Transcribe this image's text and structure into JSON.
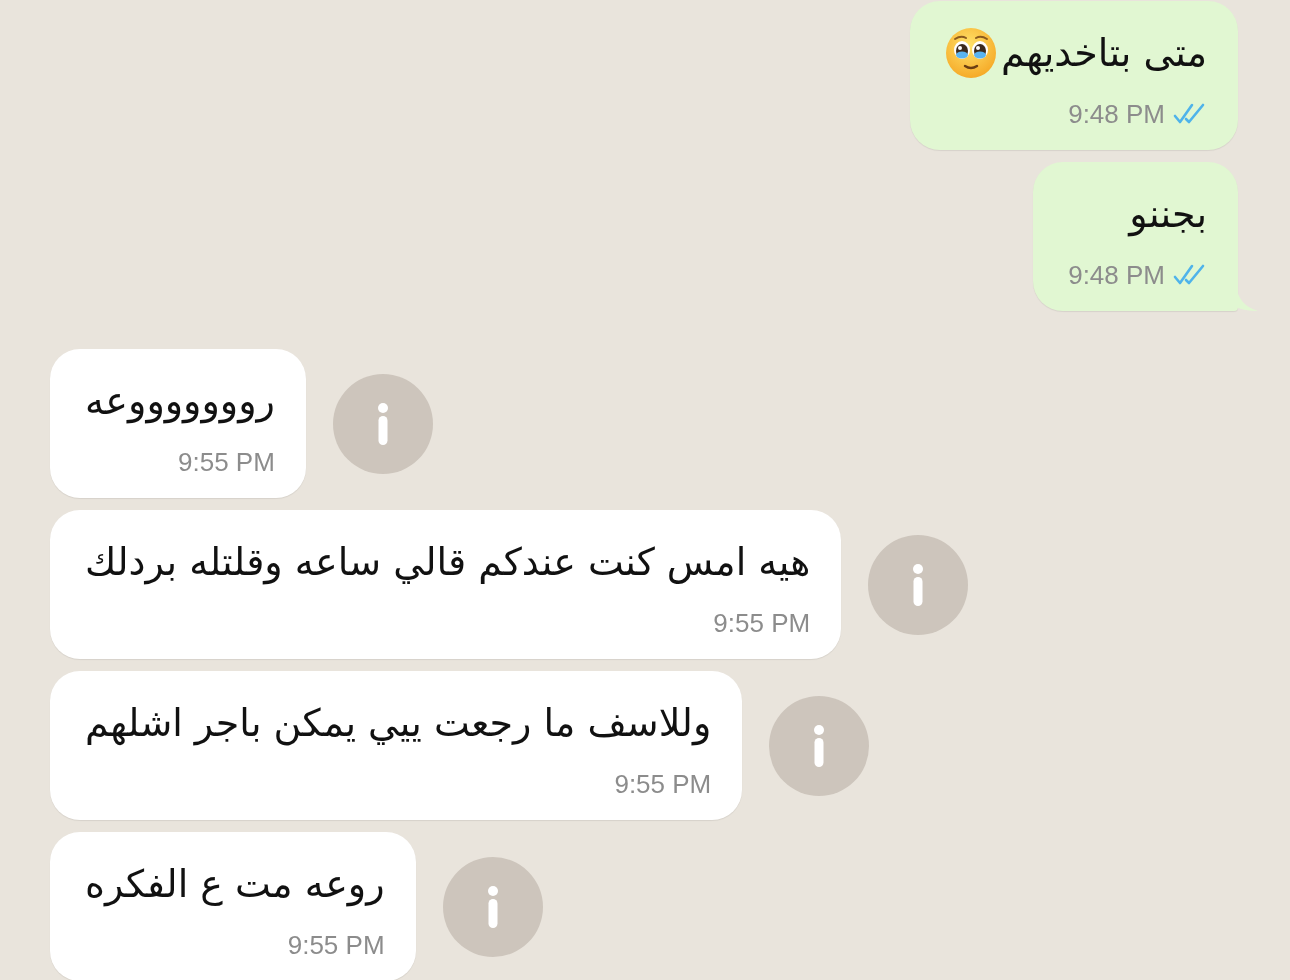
{
  "messages": [
    {
      "kind": "outgoing",
      "text": "متى بتاخديهم",
      "trailing_emoji": true,
      "time": "9:48 PM",
      "read": true,
      "tail": false
    },
    {
      "kind": "outgoing",
      "text": "بجننو",
      "trailing_emoji": false,
      "time": "9:48 PM",
      "read": true,
      "tail": true
    },
    {
      "kind": "incoming",
      "text": "روووووووعه",
      "trailing_emoji": false,
      "time": "9:55 PM",
      "tail": false
    },
    {
      "kind": "incoming",
      "text": "هيه امس كنت عندكم قالي ساعه وقلتله بردلك",
      "trailing_emoji": false,
      "time": "9:55 PM",
      "tail": false
    },
    {
      "kind": "incoming",
      "text": "وللاسف ما رجعت ييي يمكن باجر اشلهم",
      "trailing_emoji": false,
      "time": "9:55 PM",
      "tail": false
    },
    {
      "kind": "incoming",
      "text": "روعه مت ع الفكره",
      "trailing_emoji": false,
      "time": "9:55 PM",
      "tail": false
    }
  ]
}
